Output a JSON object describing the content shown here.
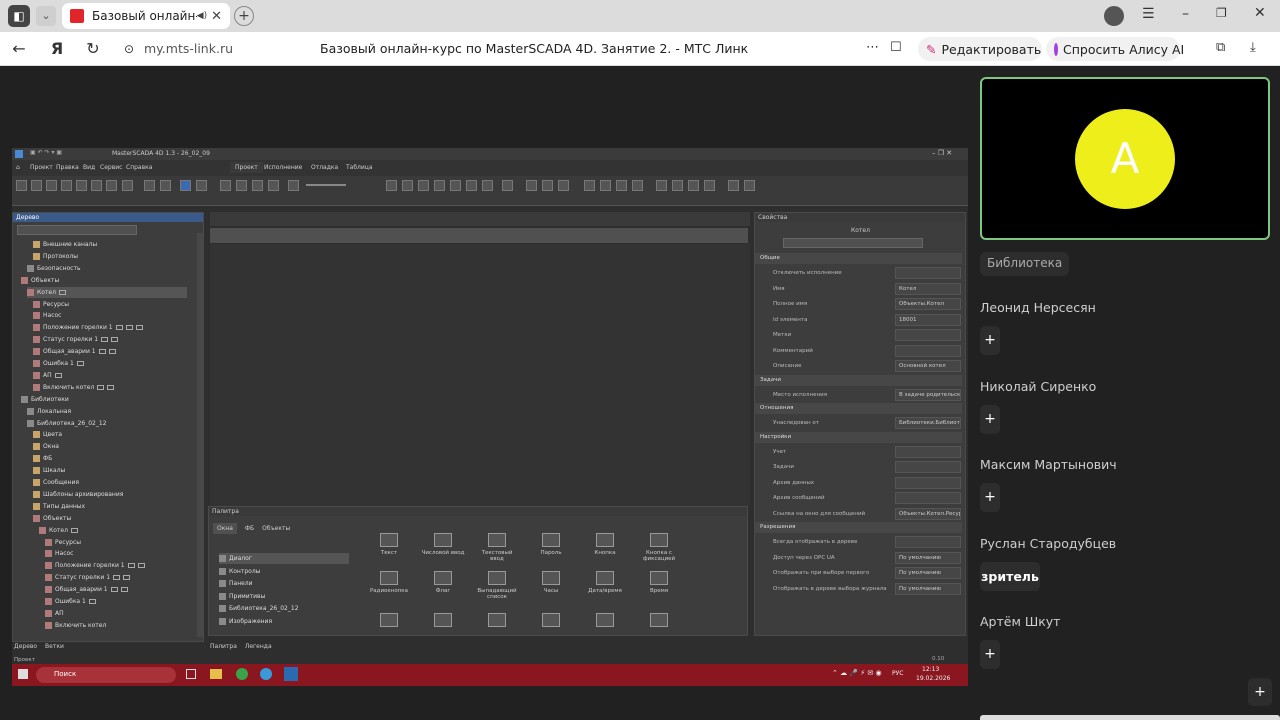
{
  "browser": {
    "tab_title": "Базовый онлайн-курс",
    "url": "my.mts-link.ru",
    "page_title": "Базовый онлайн-курс по MasterSCADA 4D. Занятие 2. - МТС Линк",
    "edit_label": "Редактировать",
    "alice_label": "Спросить Алису AI"
  },
  "app": {
    "window_title": "MasterSCADA 4D 1.3 - 26_02_09",
    "menu": [
      "Проект",
      "Правка",
      "Вид",
      "Сервис",
      "Справка"
    ],
    "ribbon_tabs": [
      "Проект",
      "Исполнение",
      "Отладка",
      "Таблица"
    ],
    "tree_title": "Дерево",
    "tree": [
      "Внешние каналы",
      "Протоколы",
      "Безопасность",
      "Объекты",
      "Котел",
      "Ресурсы",
      "Насос",
      "Положение горелки 1",
      "Статус горелки 1",
      "Общая_аварии 1",
      "Ошибка 1",
      "АП",
      "Включить котел",
      "Библиотеки",
      "Локальная",
      "Библиотека_26_02_12",
      "Цвета",
      "Окна",
      "ФБ",
      "Шкалы",
      "Сообщения",
      "Шаблоны архивирования",
      "Типы данных",
      "Объекты",
      "Котел",
      "Ресурсы",
      "Насос",
      "Положение горелки 1",
      "Статус горелки 1",
      "Общая_аварии 1",
      "Ошибка 1",
      "АП",
      "Включить котел"
    ],
    "bottom_tabs": [
      "Дерево",
      "Ветки"
    ],
    "status_left": "Проект",
    "palette_title": "Палитра",
    "palette_tabs": [
      "Окна",
      "ФБ",
      "Объекты"
    ],
    "palette_list": [
      "Диалог",
      "Контролы",
      "Панели",
      "Примитивы",
      "Библиотека_26_02_12",
      "Изображения"
    ],
    "palette_items": [
      "Текст",
      "Числовой ввод",
      "Текстовый ввод",
      "Пароль",
      "Кнопка",
      "Кнопка с фиксацией",
      "Радиокнопка",
      "Флаг",
      "Выпадающий список",
      "Часы",
      "Дата/время",
      "Время"
    ],
    "palette_bottom_tabs": [
      "Палитра",
      "Легенда"
    ],
    "props_title": "Свойства",
    "props_object": "Котел",
    "props": [
      {
        "section": "Общие"
      },
      {
        "label": "Отключить исполнение",
        "value": ""
      },
      {
        "label": "Имя",
        "value": "Котел"
      },
      {
        "label": "Полное имя",
        "value": "Объекты.Котел"
      },
      {
        "label": "Id элемента",
        "value": "18001"
      },
      {
        "label": "Метки",
        "value": ""
      },
      {
        "label": "Комментарий",
        "value": ""
      },
      {
        "label": "Описание",
        "value": "Основной котел"
      },
      {
        "section": "Задачи"
      },
      {
        "label": "Место исполнения",
        "value": "В задаче родительского"
      },
      {
        "section": "Отношения"
      },
      {
        "label": "Унаследован от",
        "value": "Библиотеки.Библиоте"
      },
      {
        "section": "Настройки"
      },
      {
        "label": "Учет",
        "value": ""
      },
      {
        "label": "Задачи",
        "value": ""
      },
      {
        "label": "Архив данных",
        "value": ""
      },
      {
        "label": "Архив сообщений",
        "value": ""
      },
      {
        "label": "Ссылка на окно для сообщений",
        "value": "Объекты.Котел.Ресурс"
      },
      {
        "section": "Разрешения"
      },
      {
        "label": "Всегда отображать в дереве",
        "value": ""
      },
      {
        "label": "Доступ через OPC UA",
        "value": "По умолчанию"
      },
      {
        "label": "Отображать при выборе первого",
        "value": "По умолчанию"
      },
      {
        "label": "Отображать в дереве выбора журнала",
        "value": "По умолчанию"
      }
    ],
    "zoom": "0.10",
    "taskbar_search": "Поиск",
    "clock_time": "12:13",
    "clock_date": "19.02.2026",
    "lang": "РУС"
  },
  "sidebar": {
    "avatar_letter": "А",
    "library_label": "Библиотека",
    "participants": [
      {
        "name": "Леонид Нерсесян",
        "button": "+"
      },
      {
        "name": "Николай Сиренко",
        "button": "+"
      },
      {
        "name": "Максим Мартынович",
        "button": "+"
      },
      {
        "name": "Руслан Стародубцев",
        "button": "зритель"
      },
      {
        "name": "Артём Шкут",
        "button": "+"
      }
    ],
    "corner_plus": "+"
  }
}
